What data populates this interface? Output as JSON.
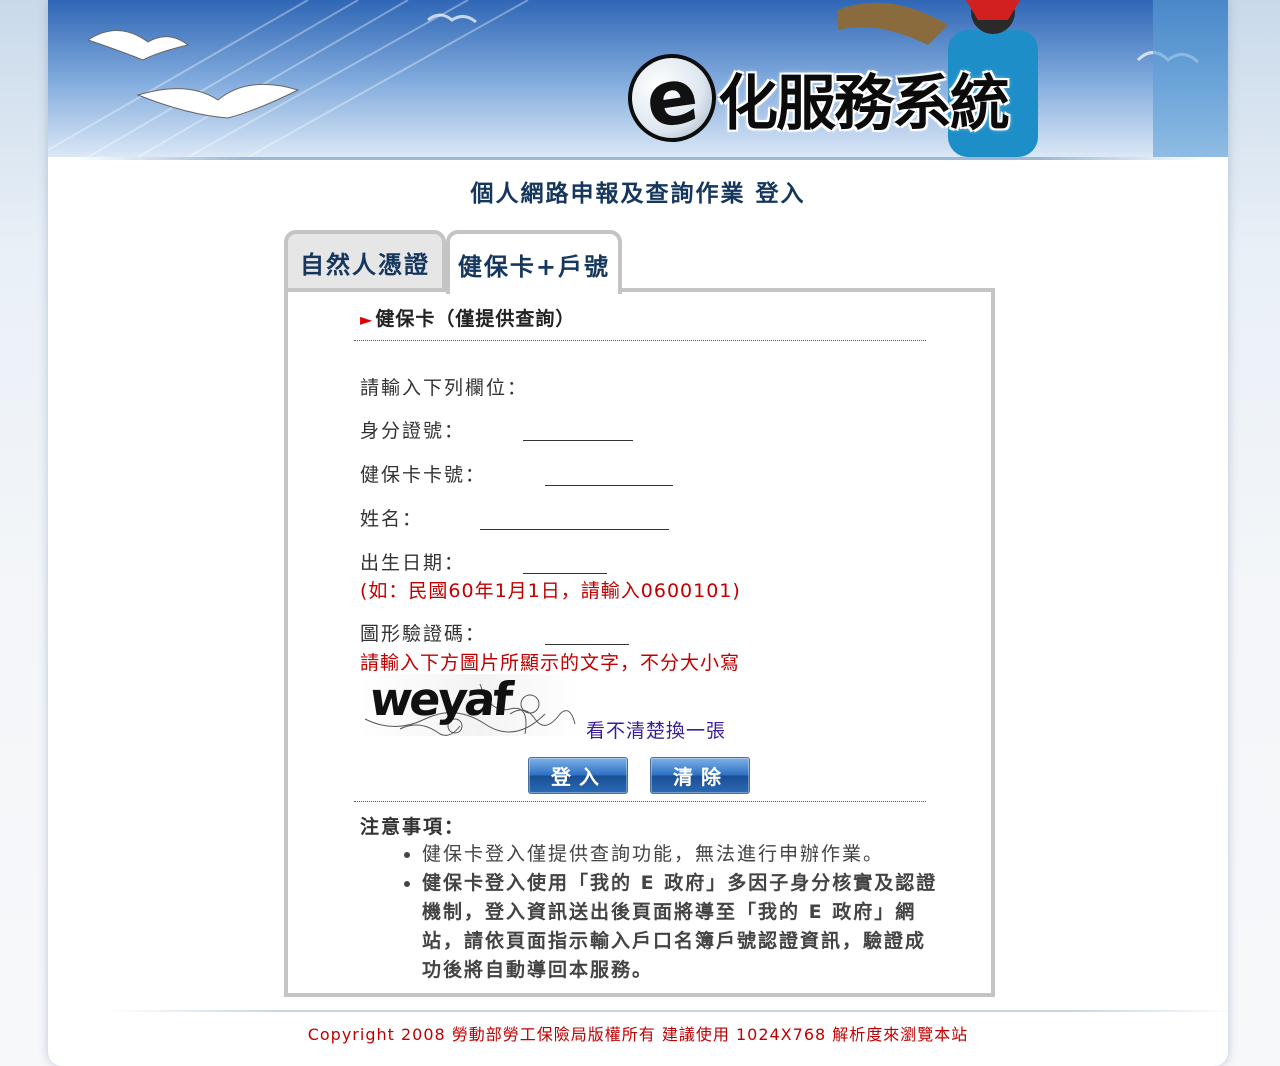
{
  "banner": {
    "logo_letter": "e",
    "system_title": "化服務系統"
  },
  "heading": "個人網路申報及查詢作業 登入",
  "tabs": [
    {
      "label": "自然人憑證",
      "active": false
    },
    {
      "label": "健保卡+戶號",
      "active": true
    }
  ],
  "form": {
    "section_title": "健保卡（僅提供查詢）",
    "prompt": "請輸入下列欄位：",
    "id_label": "身分證號：",
    "id_value": "",
    "card_label": "健保卡卡號：",
    "card_value": "",
    "name_label": "姓名：",
    "name_value": "",
    "birth_label": "出生日期：",
    "birth_value": "",
    "birth_hint": "(如：民國60年1月1日，請輸入0600101)",
    "captcha_label": "圖形驗證碼：",
    "captcha_value": "",
    "captcha_hint": "請輸入下方圖片所顯示的文字，不分大小寫",
    "captcha_text": "weyaf",
    "captcha_refresh": "看不清楚換一張",
    "login_button": "登入",
    "clear_button": "清除"
  },
  "notes": {
    "title": "注意事項：",
    "items": [
      "健保卡登入僅提供查詢功能，無法進行申辦作業。",
      "健保卡登入使用「我的 E 政府」多因子身分核實及認證機制，登入資訊送出後頁面將導至「我的 E 政府」網站，請依頁面指示輸入戶口名簿戶號認證資訊，驗證成功後將自動導回本服務。"
    ]
  },
  "footer": "Copyright 2008 勞動部勞工保險局版權所有 建議使用 1024X768 解析度來瀏覽本站",
  "colors": {
    "heading": "#15365d",
    "hint_red": "#c00000",
    "link_purple": "#3b1e96",
    "button_blue": "#2f72c4"
  }
}
